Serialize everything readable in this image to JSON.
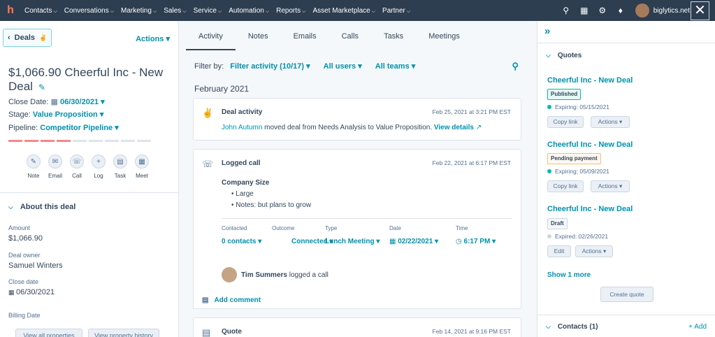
{
  "nav": {
    "logo": "h",
    "items": [
      "Contacts",
      "Conversations",
      "Marketing",
      "Sales",
      "Service",
      "Automation",
      "Reports",
      "Asset Marketplace",
      "Partner"
    ],
    "account": "biglytics.net",
    "close": "✕"
  },
  "left": {
    "back": "Deals",
    "actions": "Actions ▾",
    "title": "$1,066.90 Cheerful Inc - New Deal",
    "close_date_label": "Close Date:",
    "close_date": "06/30/2021",
    "stage_label": "Stage:",
    "stage": "Value Proposition",
    "pipeline_label": "Pipeline:",
    "pipeline": "Competitor Pipeline",
    "actions_row": [
      "Note",
      "Email",
      "Call",
      "Log",
      "Task",
      "Meet"
    ],
    "about_title": "About this deal",
    "fields": {
      "amount_label": "Amount",
      "amount": "$1,066.90",
      "owner_label": "Deal owner",
      "owner": "Samuel Winters",
      "close_label": "Close date",
      "close": "06/30/2021",
      "billing_label": "Billing Date"
    },
    "view_all": "View all properties",
    "view_history": "View property history"
  },
  "middle": {
    "tabs": [
      "Activity",
      "Notes",
      "Emails",
      "Calls",
      "Tasks",
      "Meetings"
    ],
    "filter_by": "Filter by:",
    "filter_activity": "Filter activity (10/17) ▾",
    "all_users": "All users ▾",
    "all_teams": "All teams ▾",
    "month": "February 2021",
    "deal_activity": {
      "title": "Deal activity",
      "date": "Feb 25, 2021 at 3:21 PM EST",
      "person": "John Autumn",
      "text": " moved deal from Needs Analysis to Value Proposition. ",
      "link": "View details"
    },
    "logged_call": {
      "title": "Logged call",
      "date": "Feb 22, 2021 at 6:17 PM EST",
      "heading": "Company Size",
      "bullet1": "• Large",
      "bullet2": "• Notes: but plans to grow",
      "labels": [
        "Contacted",
        "Outcome",
        "Type",
        "Date",
        "Time"
      ],
      "contacted": "0 contacts ▾",
      "outcome": "Connected ▾",
      "type": "Lunch Meeting ▾",
      "call_date": "02/22/2021 ▾",
      "call_time": "6:17 PM ▾",
      "logger": "Tim Summers",
      "logged_text": " logged a call"
    },
    "add_comment": "Add comment",
    "quote": {
      "title": "Quote",
      "date": "Feb 14, 2021 at 9:16 PM EST"
    }
  },
  "right": {
    "quotes_title": "Quotes",
    "quotes": [
      {
        "title": "Cheerful Inc - New Deal",
        "badge": "Published",
        "exp": "Expiring: 05/15/2021",
        "btn1": "Copy link",
        "btn2": "Actions ▾"
      },
      {
        "title": "Cheerful Inc - New Deal",
        "badge": "Pending payment",
        "exp": "Expiring: 05/09/2021",
        "btn1": "Copy link",
        "btn2": "Actions ▾"
      },
      {
        "title": "Cheerful Inc - New Deal",
        "badge": "Draft",
        "exp": "Expired: 02/26/2021",
        "btn1": "Edit",
        "btn2": "Actions ▾"
      }
    ],
    "show_more": "Show 1 more",
    "create_quote": "Create quote",
    "contacts_title": "Contacts (1)",
    "add": "+ Add"
  },
  "colors": {
    "nav_bg": "#2d3e50",
    "link": "#0091ae",
    "brand": "#ff7a59",
    "published": "#00bda5",
    "pending": "#f5c26b"
  }
}
